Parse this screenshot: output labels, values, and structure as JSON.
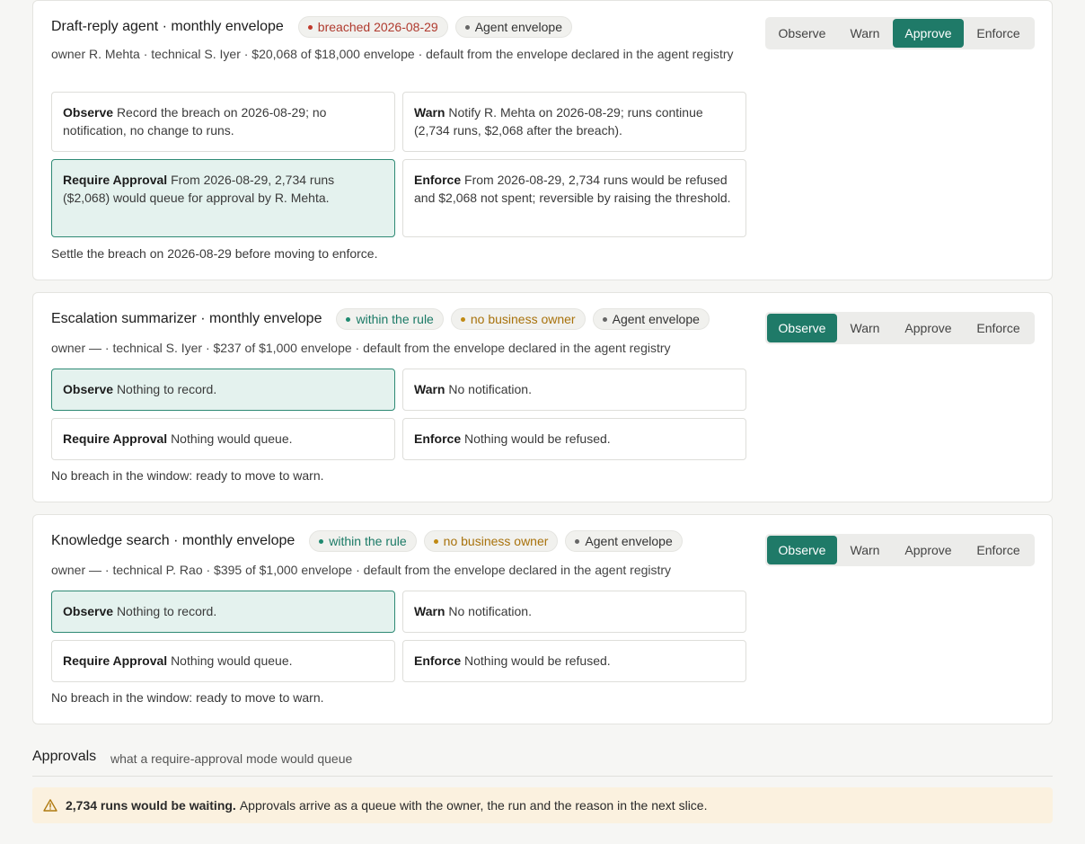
{
  "agents": [
    {
      "title": "Draft-reply agent · monthly envelope",
      "badges": [
        {
          "label": "breached 2026-08-29",
          "tone": "red"
        },
        {
          "label": "Agent envelope",
          "tone": "gray"
        }
      ],
      "meta": "owner R. Mehta · technical S. Iyer · $20,068 of $18,000 envelope · default from the envelope declared in the agent registry",
      "modes": [
        {
          "name": "Observe",
          "text": "Record the breach on 2026-08-29; no notification, no change to runs."
        },
        {
          "name": "Warn",
          "text": "Notify R. Mehta on 2026-08-29; runs continue (2,734 runs, $2,068 after the breach)."
        },
        {
          "name": "Require Approval",
          "text": "From 2026-08-29, 2,734 runs ($2,068) would queue for approval by R. Mehta."
        },
        {
          "name": "Enforce",
          "text": "From 2026-08-29, 2,734 runs would be refused and $2,068 not spent; reversible by raising the threshold."
        }
      ],
      "active_mode": "Require Approval",
      "note": "Settle the breach on 2026-08-29 before moving to enforce.",
      "segmented": {
        "options": [
          "Observe",
          "Warn",
          "Approve",
          "Enforce"
        ],
        "selected": "Approve"
      }
    },
    {
      "title": "Escalation summarizer · monthly envelope",
      "badges": [
        {
          "label": "within the rule",
          "tone": "green"
        },
        {
          "label": "no business owner",
          "tone": "amber"
        },
        {
          "label": "Agent envelope",
          "tone": "gray"
        }
      ],
      "meta": "owner — · technical S. Iyer · $237 of $1,000 envelope · default from the envelope declared in the agent registry",
      "modes": [
        {
          "name": "Observe",
          "text": "Nothing to record."
        },
        {
          "name": "Warn",
          "text": "No notification."
        },
        {
          "name": "Require Approval",
          "text": "Nothing would queue."
        },
        {
          "name": "Enforce",
          "text": "Nothing would be refused."
        }
      ],
      "active_mode": "Observe",
      "note": "No breach in the window: ready to move to warn.",
      "segmented": {
        "options": [
          "Observe",
          "Warn",
          "Approve",
          "Enforce"
        ],
        "selected": "Observe"
      }
    },
    {
      "title": "Knowledge search · monthly envelope",
      "badges": [
        {
          "label": "within the rule",
          "tone": "green"
        },
        {
          "label": "no business owner",
          "tone": "amber"
        },
        {
          "label": "Agent envelope",
          "tone": "gray"
        }
      ],
      "meta": "owner — · technical P. Rao · $395 of $1,000 envelope · default from the envelope declared in the agent registry",
      "modes": [
        {
          "name": "Observe",
          "text": "Nothing to record."
        },
        {
          "name": "Warn",
          "text": "No notification."
        },
        {
          "name": "Require Approval",
          "text": "Nothing would queue."
        },
        {
          "name": "Enforce",
          "text": "Nothing would be refused."
        }
      ],
      "active_mode": "Observe",
      "note": "No breach in the window: ready to move to warn.",
      "segmented": {
        "options": [
          "Observe",
          "Warn",
          "Approve",
          "Enforce"
        ],
        "selected": "Observe"
      }
    }
  ],
  "approvals": {
    "title": "Approvals",
    "subtitle": "what a require-approval mode would queue",
    "banner_strong": "2,734 runs would be waiting.",
    "banner_text": "Approvals arrive as a queue with the owner, the run and the reason in the next slice.",
    "banner_icon": "warning-triangle-icon"
  },
  "colors": {
    "accent": "#1f7a68",
    "active_mode_bg": "#e4f2ee",
    "breach": "#b03a2e",
    "ok": "#1b7a66",
    "caution": "#a8720c",
    "banner_bg": "#fbf1df"
  }
}
